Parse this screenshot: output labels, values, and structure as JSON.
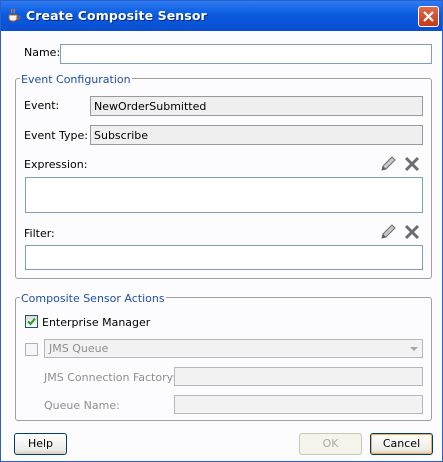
{
  "window": {
    "title": "Create Composite Sensor"
  },
  "name_field": {
    "label": "Name:",
    "value": ""
  },
  "event_config": {
    "legend": "Event Configuration",
    "event_label": "Event:",
    "event_value": "NewOrderSubmitted",
    "event_type_label": "Event Type:",
    "event_type_value": "Subscribe",
    "expression_label": "Expression:",
    "expression_value": "",
    "filter_label": "Filter:",
    "filter_value": ""
  },
  "actions": {
    "legend": "Composite Sensor Actions",
    "enterprise_manager_label": "Enterprise Manager",
    "enterprise_manager_checked": true,
    "jms_checked": false,
    "jms_queue_value": "JMS Queue",
    "jms_connection_factory_label": "JMS Connection Factory:",
    "jms_connection_factory_value": "",
    "queue_name_label": "Queue Name:",
    "queue_name_value": ""
  },
  "footer": {
    "help_label": "Help",
    "ok_label": "OK",
    "cancel_label": "Cancel"
  },
  "icons": {
    "app": "coffee-cup-icon",
    "edit": "pencil-icon",
    "clear": "delete-x-icon",
    "close": "close-icon"
  },
  "colors": {
    "title_bar": "#0a5ae0",
    "legend_text": "#1f4fa6"
  }
}
